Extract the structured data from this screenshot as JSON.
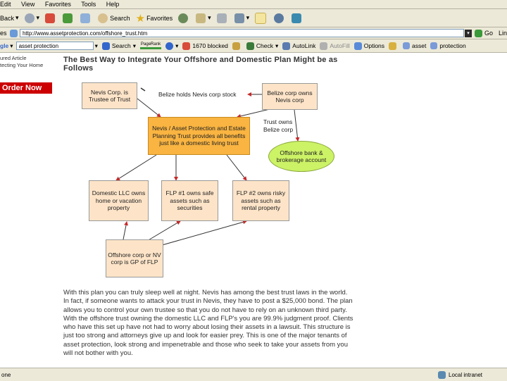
{
  "menu": [
    "Edit",
    "View",
    "Favorites",
    "Tools",
    "Help"
  ],
  "toolbar": {
    "back": "Back",
    "search": "Search",
    "favorites": "Favorites"
  },
  "address": {
    "label": "es",
    "url": "http://www.assetprotection.com/offshore_trust.htm",
    "go": "Go",
    "links": "Lin"
  },
  "google": {
    "logo": "gle",
    "query": "asset protection",
    "search": "Search",
    "pagerank": "PageRank",
    "blocked": "1670 blocked",
    "check": "Check",
    "autolink": "AutoLink",
    "autofill": "AutoFill",
    "options": "Options",
    "term1": "asset",
    "term2": "protection"
  },
  "sidebar": {
    "line1": "ured Article",
    "line2": "tecting Your Home",
    "order_now": "Order Now"
  },
  "page": {
    "heading_line1": "The Best Way to Integrate Your Offshore and Domestic Plan Might be as",
    "heading_line2": "Follows"
  },
  "diagram": {
    "nevis_corp": "Nevis Corp. is Trustee of Trust",
    "belize_holds": "Belize holds Nevis corp stock",
    "belize_owns": "Belize corp owns Nevis corp",
    "trust": "Nevis / Asset Protection and Estate Planning Trust provides all benefits just like a domestic living trust",
    "trust_owns": "Trust owns Belize corp",
    "offshore_bank": "Offshore bank & brokerage account",
    "llc": "Domestic LLC owns home or vacation property",
    "flp1": "FLP #1 owns safe assets such as securities",
    "flp2": "FLP #2 owns risky assets such as rental property",
    "offshore_corp": "Offshore corp or NV corp is GP of FLP"
  },
  "body": {
    "paragraph": "With this plan you can truly sleep well at night. Nevis has among the best trust laws in the world. In fact, if someone wants to attack your trust in Nevis, they have to post a $25,000 bond. The plan allows you to control your own trustee so that you do not have to rely on an unknown third party. With the offshore trust owning the domestic LLC and FLP's you are 99.9% judgment proof. Clients who have this set up have not had to worry about losing their assets in a lawsuit. This structure is just too strong and attorneys give up and look for easier prey. This is one of the major tenants of asset protection, look strong and impenetrable and those who seek to take your assets from you will not bother with you."
  },
  "status": {
    "left": "one",
    "zone": "Local intranet"
  }
}
